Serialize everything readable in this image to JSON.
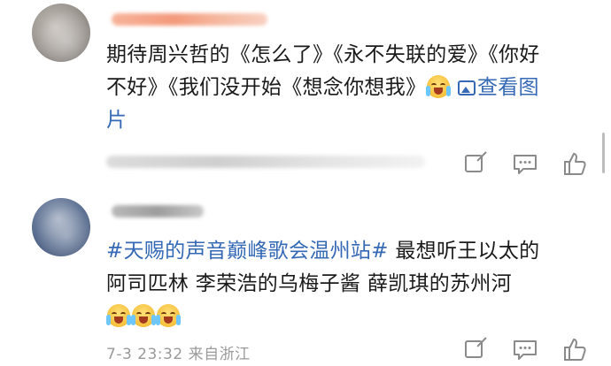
{
  "comments": [
    {
      "text_parts": {
        "line1_prefix": "期待周兴哲的《怎么了》《永不失联的爱》《你好",
        "line2_prefix": "不好》《我们没开始《想念你想我》",
        "view_image": "查看图",
        "line3": "片"
      },
      "actions": {
        "repost_icon": "repost-icon",
        "comment_icon": "comment-icon",
        "like_icon": "like-icon"
      }
    },
    {
      "text_parts": {
        "topic": "#天赐的声音巅峰歌会温州站#",
        "after_topic": " 最想听王以太的",
        "line2": "阿司匹林 李荣浩的乌梅子酱 薛凯琪的苏州河"
      },
      "meta": {
        "time": "7-3 23:32",
        "location": "来自浙江"
      },
      "actions": {
        "repost_icon": "repost-icon",
        "comment_icon": "comment-icon",
        "like_icon": "like-icon"
      }
    }
  ],
  "colors": {
    "link": "#3569b5",
    "text": "#1a1a1a",
    "muted": "#9a9a9a",
    "icon": "#8a8a8a"
  }
}
